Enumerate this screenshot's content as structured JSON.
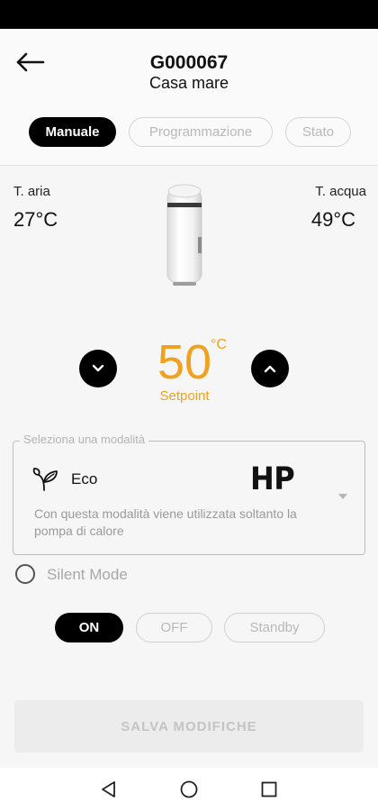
{
  "header": {
    "title": "G000067",
    "subtitle": "Casa mare",
    "tabs": [
      {
        "label": "Manuale",
        "active": true
      },
      {
        "label": "Programmazione",
        "active": false
      },
      {
        "label": "Stato",
        "active": false
      }
    ]
  },
  "temps": {
    "air_label": "T. aria",
    "air_value": "27°C",
    "water_label": "T. acqua",
    "water_value": "49°C"
  },
  "setpoint": {
    "value": "50",
    "unit": "°C",
    "label": "Setpoint"
  },
  "mode": {
    "legend": "Seleziona una modalità",
    "name": "Eco",
    "badge": "HP",
    "description": "Con questa modalità viene utilizzata soltanto la pompa di calore",
    "icon": "leaf-icon"
  },
  "silent_mode": {
    "label": "Silent Mode",
    "checked": false
  },
  "power": {
    "on": "ON",
    "off": "OFF",
    "standby": "Standby",
    "selected": "ON"
  },
  "save_label": "SALVA MODIFICHE",
  "colors": {
    "accent": "#f0a11e",
    "primary": "#000000"
  }
}
